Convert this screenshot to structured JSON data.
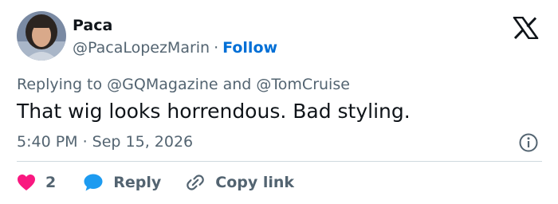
{
  "author": {
    "name": "Paca",
    "handle": "@PacaLopezMarin",
    "separator": "·",
    "follow_label": "Follow"
  },
  "reply_context": {
    "prefix": "Replying to",
    "mention_1": "@GQMagazine",
    "conjunction": "and",
    "mention_2": "@TomCruise"
  },
  "tweet": {
    "text": "That wig looks horrendous. Bad styling.",
    "timestamp": "5:40 PM · Sep 15, 2026"
  },
  "actions": {
    "like_count": "2",
    "reply_label": "Reply",
    "copy_link_label": "Copy link"
  },
  "colors": {
    "like": "#f91880",
    "reply": "#1d9bf0",
    "follow": "#006fd6",
    "secondary_text": "#536471",
    "primary_text": "#0f1419",
    "divider": "#cfd9de"
  },
  "icons": [
    "x-logo-icon",
    "info-icon",
    "heart-icon",
    "speech-bubble-icon",
    "link-icon"
  ]
}
